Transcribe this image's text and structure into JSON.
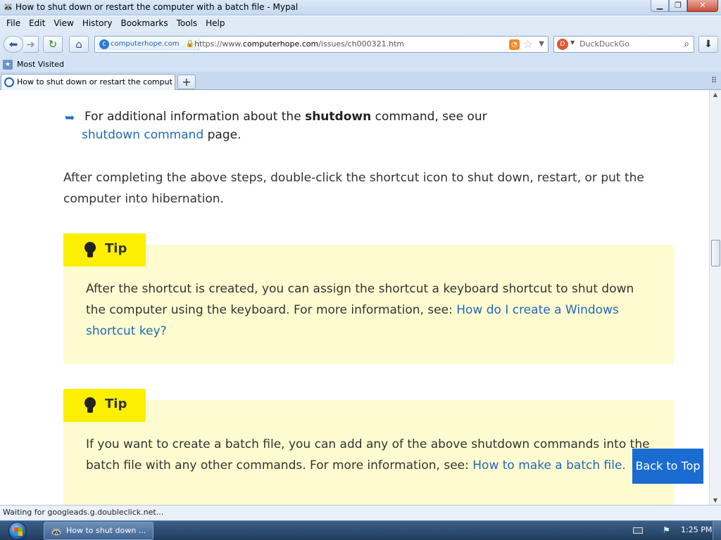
{
  "window": {
    "title": "How to shut down or restart the computer with a batch file - Mypal",
    "controls": {
      "minimize": "▁",
      "maximize": "❐",
      "close": "✕"
    }
  },
  "menu": [
    "File",
    "Edit",
    "View",
    "History",
    "Bookmarks",
    "Tools",
    "Help"
  ],
  "navbar": {
    "identity": "computerhope.com",
    "url_prefix": "https://www.",
    "url_domain": "computerhope.com",
    "url_path": "/issues/ch000321.htm",
    "search_placeholder": "DuckDuckGo"
  },
  "bookmarks": {
    "most_visited": "Most Visited"
  },
  "tabs": [
    {
      "label": "How to shut down or restart the comput..."
    }
  ],
  "content": {
    "info_before": "For additional information about the ",
    "info_cmd": "shutdown",
    "info_after": " command, see our",
    "info_link": "shutdown command",
    "info_end": " page.",
    "paragraph": "After completing the above steps, double-click the shortcut icon to shut down, restart, or put the computer into hibernation.",
    "tip1": {
      "label": "Tip",
      "text": "After the shortcut is created, you can assign the shortcut a keyboard shortcut to shut down the computer using the keyboard. For more information, see: ",
      "link": "How do I create a Windows shortcut key?"
    },
    "tip2": {
      "label": "Tip",
      "text": "If you want to create a batch file, you can add any of the above shutdown commands into the batch file with any other commands. For more information, see: ",
      "link": "How to make a batch file."
    },
    "back_to_top": "Back to Top"
  },
  "status": "Waiting for googleads.g.doubleclick.net...",
  "taskbar": {
    "task_label": "How to shut down ...",
    "clock": "1:25 PM"
  },
  "colors": {
    "link": "#2068b8",
    "tip_bg": "#fffbd0",
    "tip_tab": "#fcef00",
    "back_to_top": "#1a6cd1"
  }
}
